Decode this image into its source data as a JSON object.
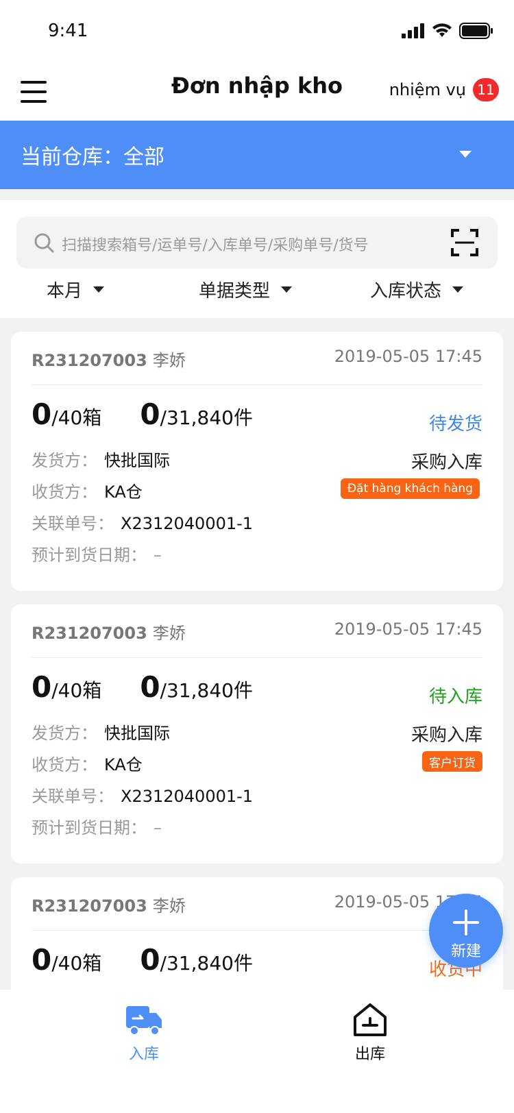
{
  "status_bar": {
    "time": "9:41"
  },
  "header": {
    "title": "Đơn nhập kho",
    "task_label": "nhiệm vụ",
    "task_count": "11"
  },
  "warehouse": {
    "label": "当前仓库：全部"
  },
  "search": {
    "placeholder": "扫描搜索箱号/运单号/入库单号/采购单号/货号"
  },
  "filters": [
    {
      "label": "本月"
    },
    {
      "label": "单据类型"
    },
    {
      "label": "入库状态"
    }
  ],
  "cards": [
    {
      "order_no": "R231207003",
      "owner": "李娇",
      "datetime": "2019-05-05 17:45",
      "box_done": "0",
      "box_total": "/40箱",
      "piece_done": "0",
      "piece_total": "/31,840件",
      "status": "待发货",
      "status_color": "#3f86f0",
      "order_type": "采购入库",
      "tag": "Đặt hàng khách hàng",
      "shipper_label": "发货方：",
      "shipper": "快批国际",
      "receiver_label": "收货方：",
      "receiver": "KA仓",
      "related_label": "关联单号：",
      "related": "X2312040001-1",
      "eta_label": "预计到货日期：",
      "eta": "–"
    },
    {
      "order_no": "R231207003",
      "owner": "李娇",
      "datetime": "2019-05-05 17:45",
      "box_done": "0",
      "box_total": "/40箱",
      "piece_done": "0",
      "piece_total": "/31,840件",
      "status": "待入库",
      "status_color": "#1ea11e",
      "order_type": "采购入库",
      "tag": "客户订货",
      "shipper_label": "发货方：",
      "shipper": "快批国际",
      "receiver_label": "收货方：",
      "receiver": "KA仓",
      "related_label": "关联单号：",
      "related": "X2312040001-1",
      "eta_label": "预计到货日期：",
      "eta": "–"
    },
    {
      "order_no": "R231207003",
      "owner": "李娇",
      "datetime": "2019-05-05 17:45",
      "box_done": "0",
      "box_total": "/40箱",
      "piece_done": "0",
      "piece_total": "/31,840件",
      "status": "收货中",
      "status_color": "#f56a14"
    }
  ],
  "fab": {
    "label": "新建"
  },
  "tabs": [
    {
      "label": "入库",
      "active": true,
      "color": "#4f8ef7",
      "icon": "truck-icon"
    },
    {
      "label": "出库",
      "active": false,
      "color": "#111111",
      "icon": "warehouse-out-icon"
    }
  ],
  "colors": {
    "accent": "#4f8ef7",
    "badge": "#f02b2b",
    "tag": "#f96314"
  }
}
